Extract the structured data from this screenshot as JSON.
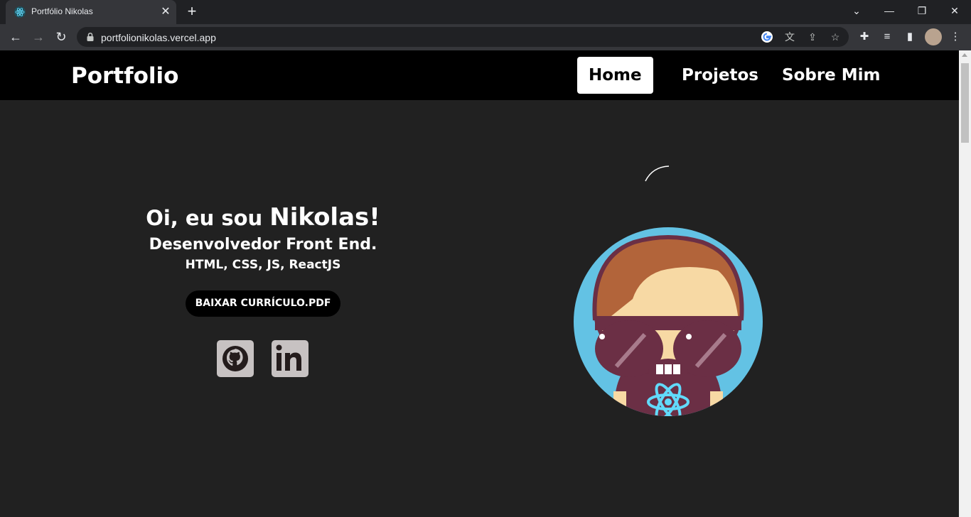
{
  "browser": {
    "tab_title": "Portfólio Nikolas",
    "url": "portfolionikolas.vercel.app"
  },
  "site": {
    "brand": "Portfolio",
    "nav": [
      {
        "label": "Home",
        "active": true
      },
      {
        "label": "Projetos",
        "active": false
      },
      {
        "label": "Sobre Mim",
        "active": false
      }
    ],
    "hero": {
      "greeting": "Oi, eu sou ",
      "name": "Nikolas!",
      "role": "Desenvolvedor Front End.",
      "skills": "HTML, CSS, JS, ReactJS",
      "cv_button": "BAIXAR CURRÍCULO.PDF"
    },
    "social": [
      {
        "icon": "github-icon"
      },
      {
        "icon": "linkedin-icon"
      }
    ]
  },
  "colors": {
    "page_bg": "#212121",
    "navbar_bg": "#000000",
    "active_nav_bg": "#ffffff",
    "social_bg": "#c7c2c2",
    "avatar_circle": "#63c2e4"
  }
}
